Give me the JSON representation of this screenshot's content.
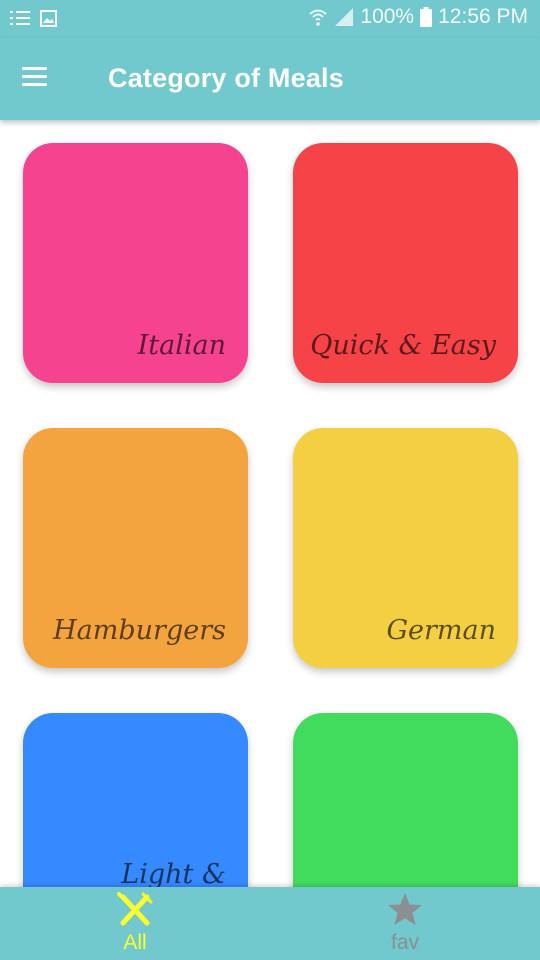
{
  "status_bar": {
    "battery": "100%",
    "time": "12:56 PM",
    "icons": [
      "notification-list-icon",
      "image-icon",
      "wifi-icon",
      "signal-icon",
      "battery-icon"
    ]
  },
  "app_bar": {
    "title": "Category of Meals",
    "menu_icon": "hamburger-menu-icon"
  },
  "categories": [
    {
      "label": "Italian",
      "color": "#f5438f"
    },
    {
      "label": "Quick & Easy",
      "color": "#f64347"
    },
    {
      "label": "Hamburgers",
      "color": "#f4a43e"
    },
    {
      "label": "German",
      "color": "#f4cf42"
    },
    {
      "label": "Light &",
      "color": "#3689fe"
    },
    {
      "label": "",
      "color": "#41dc5e"
    }
  ],
  "bottom_nav": {
    "items": [
      {
        "label": "All",
        "icon": "cutlery-icon",
        "active": true,
        "color": "#ffff2b"
      },
      {
        "label": "fav",
        "icon": "star-icon",
        "active": false,
        "color": "#8a8f94"
      }
    ]
  },
  "colors": {
    "primary": "#71c8cd",
    "accent": "#ffff2b",
    "inactive": "#8a8f94"
  }
}
